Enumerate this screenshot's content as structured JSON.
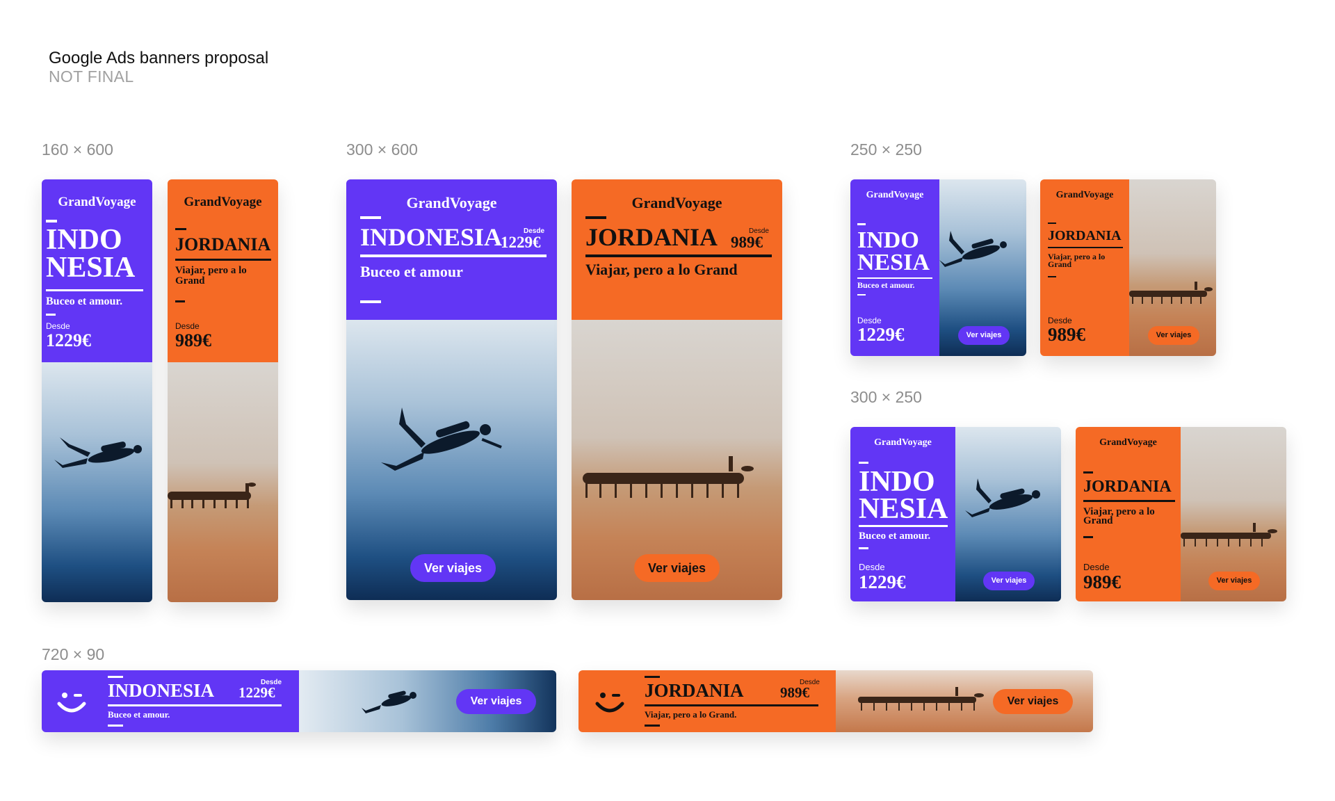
{
  "page": {
    "title": "Google Ads banners proposal",
    "subtitle": "NOT FINAL"
  },
  "sizes": {
    "s160x600": "160 × 600",
    "s300x600": "300 × 600",
    "s250x250": "250 × 250",
    "s300x250": "300 × 250",
    "s720x90": "720 × 90"
  },
  "brand": "GrandVoyage",
  "indonesia": {
    "name": "INDONESIA",
    "line1": "INDO",
    "line2": "NESIA",
    "tagline": "Buceo et amour.",
    "tagline_short": "Buceo et amour",
    "from_label": "Desde",
    "price": "1229€",
    "cta": "Ver viajes"
  },
  "jordania": {
    "name": "JORDANIA",
    "tagline": "Viajar, pero a lo Grand",
    "tagline_dot": "Viajar, pero a lo Grand.",
    "from_label": "Desde",
    "price": "989€",
    "cta": "Ver viajes"
  },
  "colors": {
    "purple": "#6236f5",
    "orange": "#f56a25",
    "text_dark": "#111111",
    "label_gray": "#8d8d8d"
  },
  "icons": {
    "wink": "winking-face-icon",
    "diver": "scuba-diver-photo",
    "camels": "camel-caravan-photo"
  }
}
